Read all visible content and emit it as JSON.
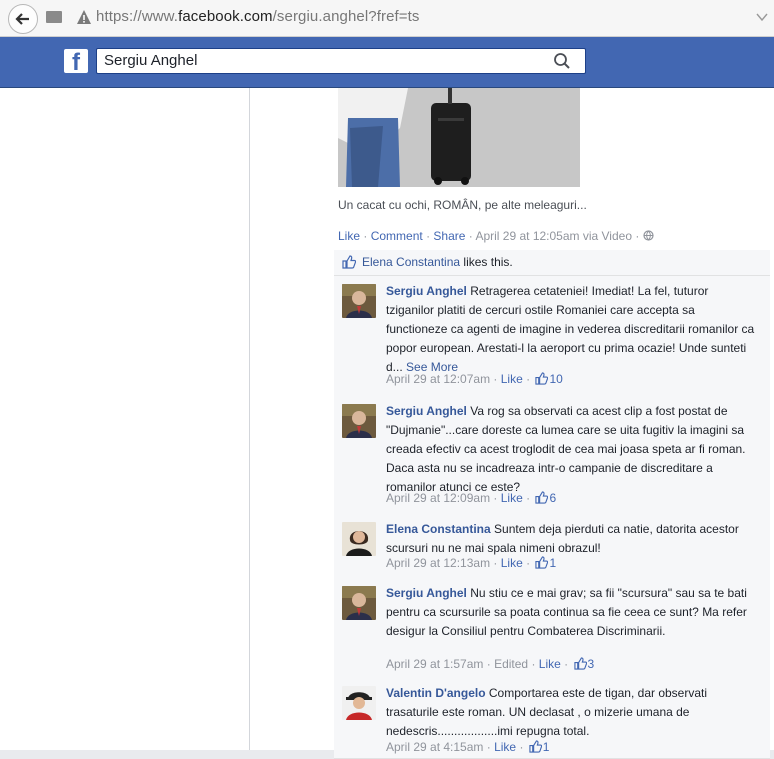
{
  "browser": {
    "url_prefix": "https://www.",
    "url_domain": "facebook.com",
    "url_path": "/sergiu.anghel?fref=ts"
  },
  "header": {
    "logo": "f",
    "search_value": "Sergiu Anghel"
  },
  "post": {
    "caption": "Un cacat cu ochi, ROMÂN, pe alte meleaguri...",
    "like_label": "Like",
    "comment_label": "Comment",
    "share_label": "Share",
    "timestamp": "April 29 at 12:05am via Video",
    "liked_by": "Elena Constantina",
    "likes_suffix": " likes this."
  },
  "comments": [
    {
      "author": "Sergiu Anghel",
      "text": "Retragerea cetateniei! Imediat! La fel, tuturor tziganilor platiti de cercuri ostile Romaniei care accepta sa functioneze ca agenti de imagine in vederea discreditarii romanilor ca popor european. Arestati-l la aeroport cu prima ocazie! Unde sunteti d...",
      "see_more": "See More",
      "time": "April 29 at 12:07am",
      "like": "Like",
      "edited": "",
      "count": "10"
    },
    {
      "author": "Sergiu Anghel",
      "text": "Va rog sa observati ca acest clip a fost postat de \"Dujmanie\"...care doreste ca lumea care se uita fugitiv la imagini sa creada efectiv ca acest troglodit de cea mai joasa speta ar fi roman. Daca asta nu se incadreaza intr-o campanie de discreditare a romanilor atunci ce este?",
      "see_more": "",
      "time": "April 29 at 12:09am",
      "like": "Like",
      "edited": "",
      "count": "6"
    },
    {
      "author": "Elena Constantina",
      "text": "Suntem deja pierduti ca natie, datorita acestor scursuri nu ne mai spala nimeni obrazul!",
      "see_more": "",
      "time": "April 29 at 12:13am",
      "like": "Like",
      "edited": "",
      "count": "1"
    },
    {
      "author": "Sergiu Anghel",
      "text": "Nu stiu ce e mai grav; sa fii \"scursura\" sau sa te bati pentru ca scursurile sa poata continua sa fie ceea ce sunt? Ma refer desigur la Consiliul pentru Combaterea Discriminarii.",
      "see_more": "",
      "time": "April 29 at 1:57am",
      "like": "Like",
      "edited": "Edited",
      "count": "3"
    },
    {
      "author": "Valentin D'angelo",
      "text": "Comportarea este de tigan, dar observati trasaturile este roman. UN declasat , o mizerie umana de nedescris..................imi repugna total.",
      "see_more": "",
      "time": "April 29 at 4:15am",
      "like": "Like",
      "edited": "",
      "count": "1"
    }
  ],
  "colors": {
    "facebook_blue": "#4267b2",
    "link": "#365899",
    "meta_gray": "#90949c"
  }
}
